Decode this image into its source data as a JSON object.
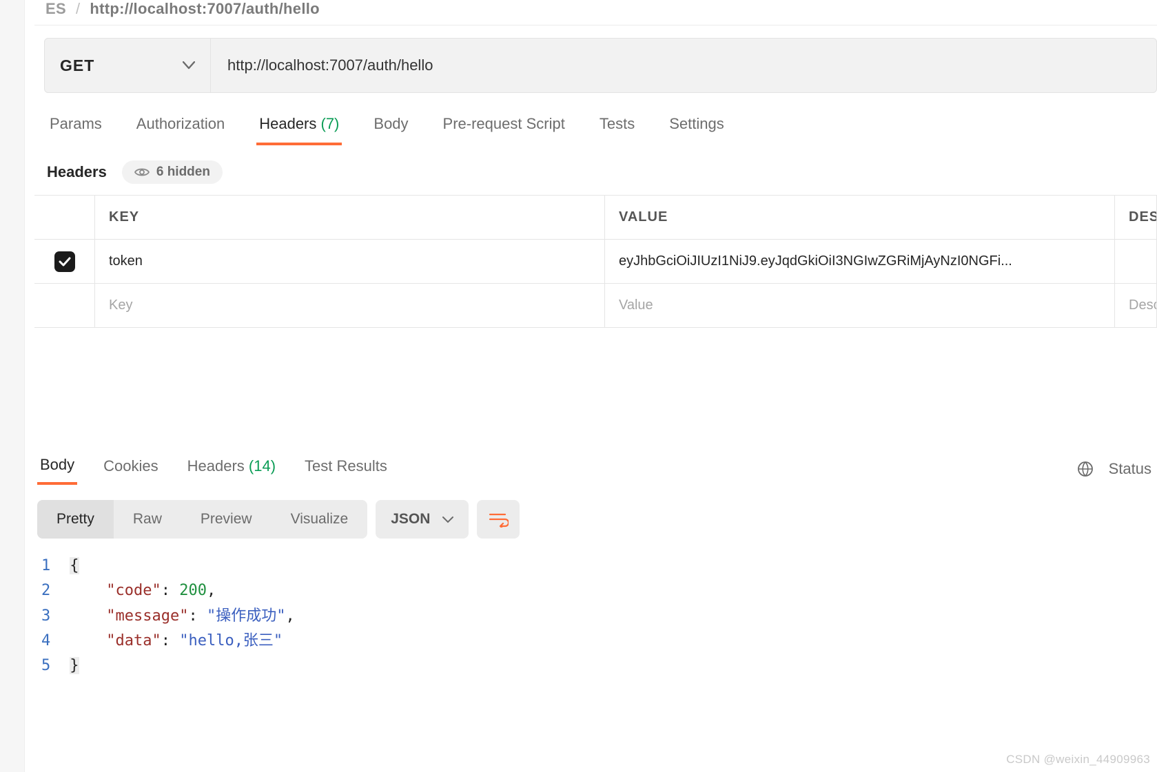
{
  "breadcrumb": {
    "collection": "ES",
    "sep": "/",
    "url": "http://localhost:7007/auth/hello"
  },
  "request": {
    "method": "GET",
    "url": "http://localhost:7007/auth/hello",
    "tabs": {
      "params": "Params",
      "authorization": "Authorization",
      "headers_label": "Headers",
      "headers_count": "(7)",
      "body": "Body",
      "prerequest": "Pre-request Script",
      "tests": "Tests",
      "settings": "Settings"
    },
    "headers_section": {
      "label": "Headers",
      "hidden_pill": "6 hidden",
      "columns": {
        "key": "KEY",
        "value": "VALUE",
        "desc": "DESC"
      },
      "rows": [
        {
          "enabled": true,
          "key": "token",
          "value": "eyJhbGciOiJIUzI1NiJ9.eyJqdGkiOiI3NGIwZGRiMjAyNzI0NGFi..."
        }
      ],
      "placeholders": {
        "key": "Key",
        "value": "Value",
        "desc": "Descr"
      }
    }
  },
  "response": {
    "tabs": {
      "body": "Body",
      "cookies": "Cookies",
      "headers_label": "Headers",
      "headers_count": "(14)",
      "test_results": "Test Results"
    },
    "status_label": "Status",
    "viewmode": {
      "pretty": "Pretty",
      "raw": "Raw",
      "preview": "Preview",
      "visualize": "Visualize"
    },
    "format": "JSON",
    "line_numbers": [
      "1",
      "2",
      "3",
      "4",
      "5"
    ],
    "json_lines": [
      {
        "type": "brace",
        "text": "{"
      },
      {
        "type": "kv",
        "indent": "    ",
        "key": "\"code\"",
        "sep": ": ",
        "val": "200",
        "valClass": "num",
        "comma": ","
      },
      {
        "type": "kv",
        "indent": "    ",
        "key": "\"message\"",
        "sep": ": ",
        "val": "\"操作成功\"",
        "valClass": "vstr",
        "comma": ","
      },
      {
        "type": "kv",
        "indent": "    ",
        "key": "\"data\"",
        "sep": ": ",
        "val": "\"hello,张三\"",
        "valClass": "vstr",
        "comma": ""
      },
      {
        "type": "brace",
        "text": "}"
      }
    ]
  },
  "watermark": "CSDN @weixin_44909963"
}
